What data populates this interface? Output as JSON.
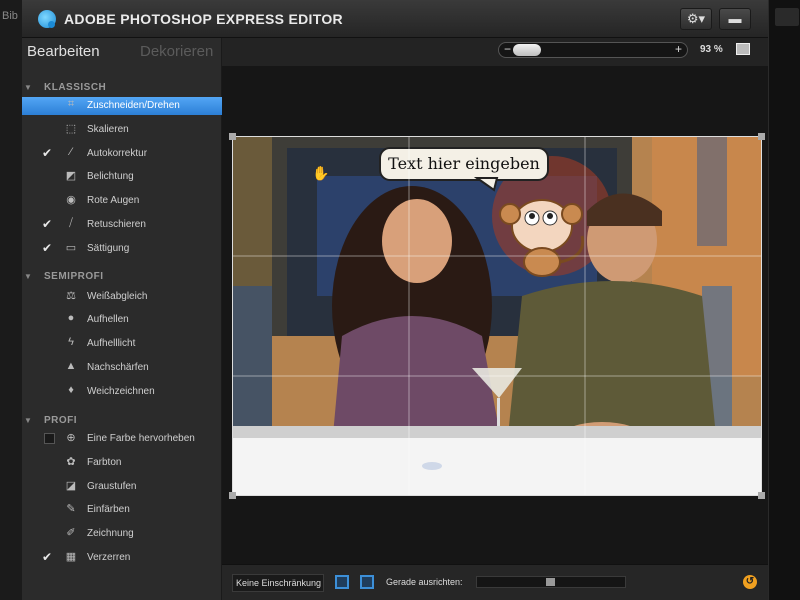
{
  "window": {
    "title": "ADOBE PHOTOSHOP EXPRESS EDITOR"
  },
  "background": {
    "text": "Bib"
  },
  "toolbar": {
    "settings_icon": "gear-icon",
    "fullscreen_icon": "fullscreen-icon"
  },
  "sidebar": {
    "tab_active": "Bearbeiten",
    "tab_inactive": "Dekorieren",
    "sections": {
      "klassisch": "KLASSISCH",
      "semiprofi": "SEMIPROFI",
      "profi": "PROFI"
    },
    "items": [
      {
        "label": "Zuschneiden/Drehen",
        "icon": "crop-icon",
        "checked": false,
        "selected": true
      },
      {
        "label": "Skalieren",
        "icon": "resize-icon",
        "checked": false
      },
      {
        "label": "Autokorrektur",
        "icon": "magic-wand-icon",
        "checked": true
      },
      {
        "label": "Belichtung",
        "icon": "exposure-icon",
        "checked": false
      },
      {
        "label": "Rote Augen",
        "icon": "eye-icon",
        "checked": false
      },
      {
        "label": "Retuschieren",
        "icon": "bandage-icon",
        "checked": true
      },
      {
        "label": "Sättigung",
        "icon": "saturation-icon",
        "checked": true
      },
      {
        "label": "Weißabgleich",
        "icon": "balance-icon",
        "checked": false
      },
      {
        "label": "Aufhellen",
        "icon": "bulb-icon",
        "checked": false
      },
      {
        "label": "Aufhelllicht",
        "icon": "lightning-icon",
        "checked": false
      },
      {
        "label": "Nachschärfen",
        "icon": "sharpen-icon",
        "checked": false
      },
      {
        "label": "Weichzeichnen",
        "icon": "drop-icon",
        "checked": false
      },
      {
        "label": "Eine Farbe hervorheben",
        "icon": "crosshair-icon",
        "checked": false,
        "checkbox": true
      },
      {
        "label": "Farbton",
        "icon": "palette-icon",
        "checked": false
      },
      {
        "label": "Graustufen",
        "icon": "grayscale-icon",
        "checked": false
      },
      {
        "label": "Einfärben",
        "icon": "pipette-icon",
        "checked": false
      },
      {
        "label": "Zeichnung",
        "icon": "pencil-icon",
        "checked": false
      },
      {
        "label": "Verzerren",
        "icon": "distort-icon",
        "checked": true
      }
    ]
  },
  "zoom": {
    "minus": "−",
    "plus": "+",
    "value": "93 %",
    "level": 0.12
  },
  "canvas": {
    "speech_bubble": "Text hier eingeben"
  },
  "bottom": {
    "constraint": "Keine Einschränkung",
    "straighten_label": "Gerade ausrichten:",
    "straighten_level": 0.5,
    "reset_icon": "reset-icon"
  },
  "colors": {
    "accent": "#3c8fd8",
    "selection": "#3f95ea",
    "reset": "#f0a020"
  }
}
